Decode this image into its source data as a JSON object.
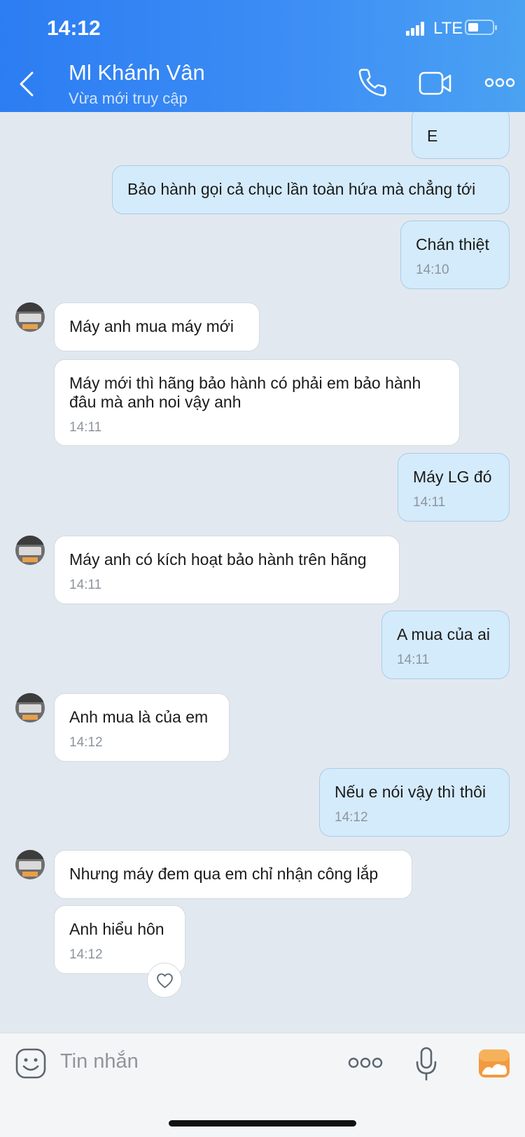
{
  "status_bar": {
    "time": "14:12",
    "network": "LTE"
  },
  "header": {
    "contact_name": "Ml Khánh Vân",
    "contact_status": "Vừa mới truy cập",
    "icons": [
      "back-chevron-icon",
      "phone-icon",
      "video-call-icon",
      "more-options-icon"
    ]
  },
  "messages": [
    {
      "dir": "out",
      "text": "E"
    },
    {
      "dir": "out",
      "text": "Bảo hành gọi cả chục lần toàn hứa mà chẳng tới"
    },
    {
      "dir": "out",
      "text": "Chán thiệt",
      "time": "14:10"
    },
    {
      "dir": "in",
      "text": "Máy anh mua máy mới"
    },
    {
      "dir": "in",
      "text": "Máy mới thì hãng bảo hành có phải em bảo hành đâu mà anh noi vậy anh",
      "time": "14:11"
    },
    {
      "dir": "out",
      "text": "Máy LG đó",
      "time": "14:11"
    },
    {
      "dir": "in",
      "text": "Máy anh có kích hoạt bảo hành trên hãng",
      "time": "14:11"
    },
    {
      "dir": "out",
      "text": "A mua của ai",
      "time": "14:11"
    },
    {
      "dir": "in",
      "text": "Anh mua là của em",
      "time": "14:12"
    },
    {
      "dir": "out",
      "text": "Nếu e nói vậy thì thôi",
      "time": "14:12"
    },
    {
      "dir": "in",
      "text": "Nhưng máy đem qua em chỉ nhận công lắp"
    },
    {
      "dir": "in",
      "text": "Anh hiểu hôn",
      "time": "14:12"
    }
  ],
  "composer": {
    "placeholder": "Tin nhắn",
    "icons": [
      "sticker-icon",
      "more-icon",
      "microphone-icon",
      "photo-gallery-icon"
    ]
  },
  "colors": {
    "header_start": "#2c7df2",
    "header_end": "#4aa2f2",
    "outgoing_bubble": "#d4ebfc",
    "incoming_bubble": "#ffffff",
    "chat_background": "#e2e8f0"
  }
}
